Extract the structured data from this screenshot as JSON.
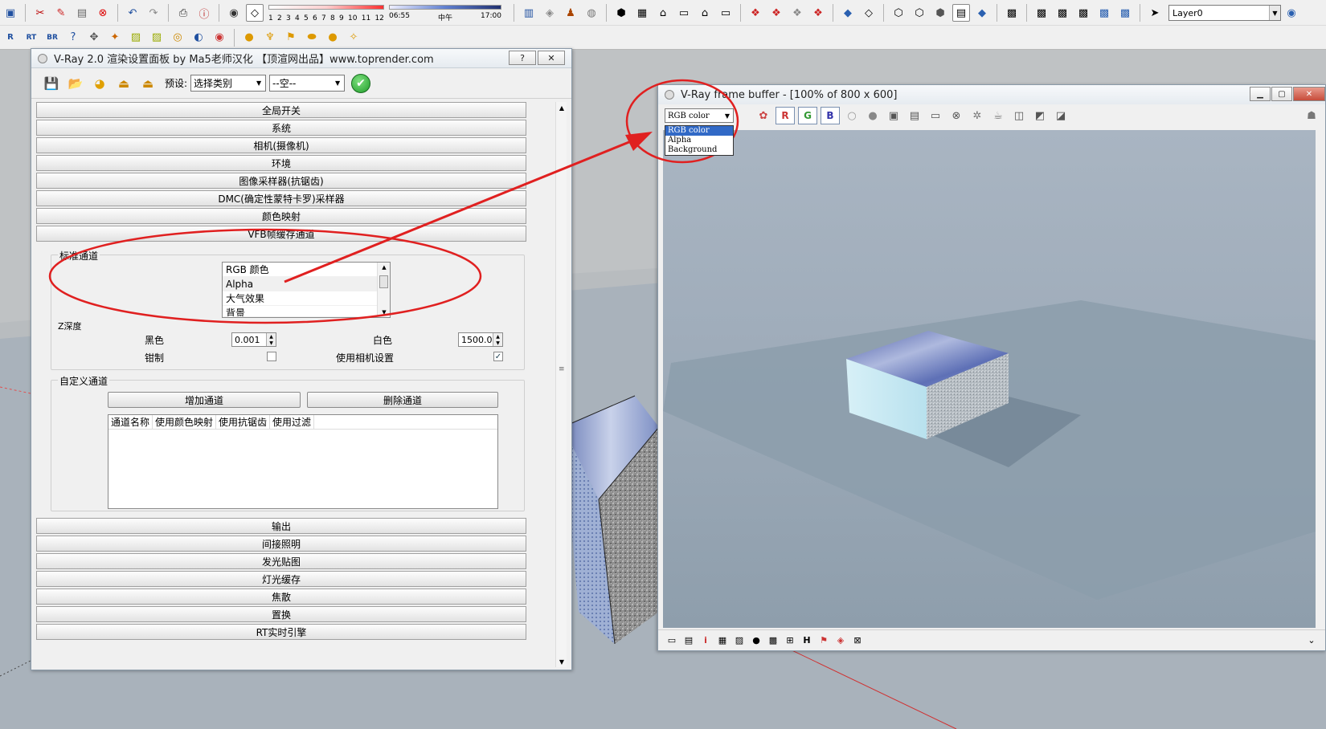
{
  "toolbar": {
    "row1_icons": [
      "layout-icon",
      "scissors-icon",
      "paint-icon",
      "clipboard-icon",
      "erase-icon",
      "undo-icon",
      "redo-icon",
      "print-icon",
      "model-info-icon",
      "orbit-icon",
      "eraser-tool-icon"
    ],
    "shadow_scale_labels": [
      "1",
      "2",
      "3",
      "4",
      "5",
      "6",
      "7",
      "8",
      "9",
      "10",
      "11",
      "12"
    ],
    "time_start": "06:55",
    "time_mid": "中午",
    "time_end": "17:00",
    "layer_value": "Layer0"
  },
  "dialog": {
    "title": "V-Ray 2.0 渲染设置面板 by Ma5老师汉化 【顶渲网出品】www.toprender.com",
    "help_btn": "?",
    "close_btn": "✕",
    "preset_label": "预设:",
    "preset_category": "选择类别",
    "preset_value": "--空--",
    "rollouts_top": [
      "全局开关",
      "系统",
      "相机(摄像机)",
      "环境",
      "图像采样器(抗锯齿)",
      "DMC(确定性蒙特卡罗)采样器",
      "颜色映射",
      "VFB帧缓存通道"
    ],
    "standard_channels": {
      "label": "标准通道",
      "items": [
        "RGB 颜色",
        "Alpha",
        "大气效果",
        "背景"
      ]
    },
    "zdepth": {
      "label": "Z深度",
      "black_label": "黑色",
      "black_value": "0.001",
      "white_label": "白色",
      "white_value": "1500.0",
      "clamp_label": "钳制",
      "use_camera_label": "使用相机设置",
      "use_camera_checked": "✓"
    },
    "custom_channels": {
      "label": "自定义通道",
      "add_btn": "增加通道",
      "delete_btn": "删除通道",
      "columns": [
        "通道名称",
        "使用颜色映射",
        "使用抗锯齿",
        "使用过滤"
      ]
    },
    "rollouts_bottom": [
      "输出",
      "间接照明",
      "发光贴图",
      "灯光缓存",
      "焦散",
      "置换",
      "RT实时引擎"
    ]
  },
  "vfb": {
    "title": "V-Ray frame buffer - [100% of 800 x 600]",
    "channel_selected": "RGB color",
    "channel_options": [
      "RGB color",
      "Alpha",
      "Background"
    ],
    "r_btn": "R",
    "g_btn": "G",
    "b_btn": "B"
  },
  "colors": {
    "annotation": "#e02020",
    "selection": "#3169c6"
  }
}
